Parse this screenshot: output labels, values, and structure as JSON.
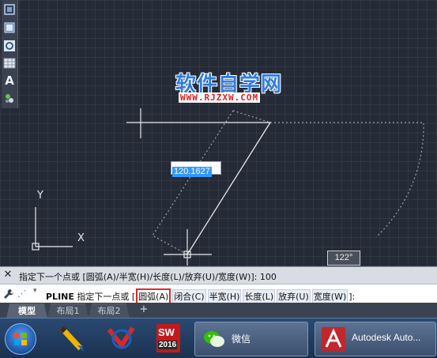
{
  "toolbar": {
    "icons": [
      "region-select-icon",
      "window-select-icon",
      "circle-tool-icon",
      "table-icon",
      "text-tool-icon",
      "layer-icon"
    ],
    "text_tool_glyph": "A"
  },
  "watermark": {
    "title": "软件自学网",
    "url": "WWW.RJZXW.COM"
  },
  "drawing": {
    "dynamic_input_value": "120.1627",
    "angle_tooltip": "122°",
    "ucs_y_label": "Y",
    "ucs_x_label": "X"
  },
  "command_history": {
    "close_glyph": "✕",
    "text": "指定下一个点或 [圆弧(A)/半宽(H)/长度(L)/放弃(U)/宽度(W)]: 100"
  },
  "command_line": {
    "command": "PLINE",
    "prompt": "指定下一点或",
    "open_bracket": "[",
    "options": [
      "圆弧(A)",
      "闭合(C)",
      "半宽(H)",
      "长度(L)",
      "放弃(U)",
      "宽度(W)"
    ],
    "suffix": "]:"
  },
  "layout_tabs": {
    "tabs": [
      "模型",
      "布局1",
      "布局2"
    ],
    "active": "模型",
    "add_glyph": "+"
  },
  "taskbar": {
    "apps": [
      {
        "name": "start"
      },
      {
        "name": "pencil-app"
      },
      {
        "name": "visual-studio"
      },
      {
        "name": "solidworks",
        "label": "2016",
        "badge": "SW"
      },
      {
        "name": "wechat",
        "label": "微信"
      },
      {
        "name": "autocad",
        "label": "Autodesk Auto..."
      }
    ]
  },
  "colors": {
    "canvas_bg": "#252b36",
    "accent": "#3399ff",
    "highlight_border": "#e32727"
  }
}
